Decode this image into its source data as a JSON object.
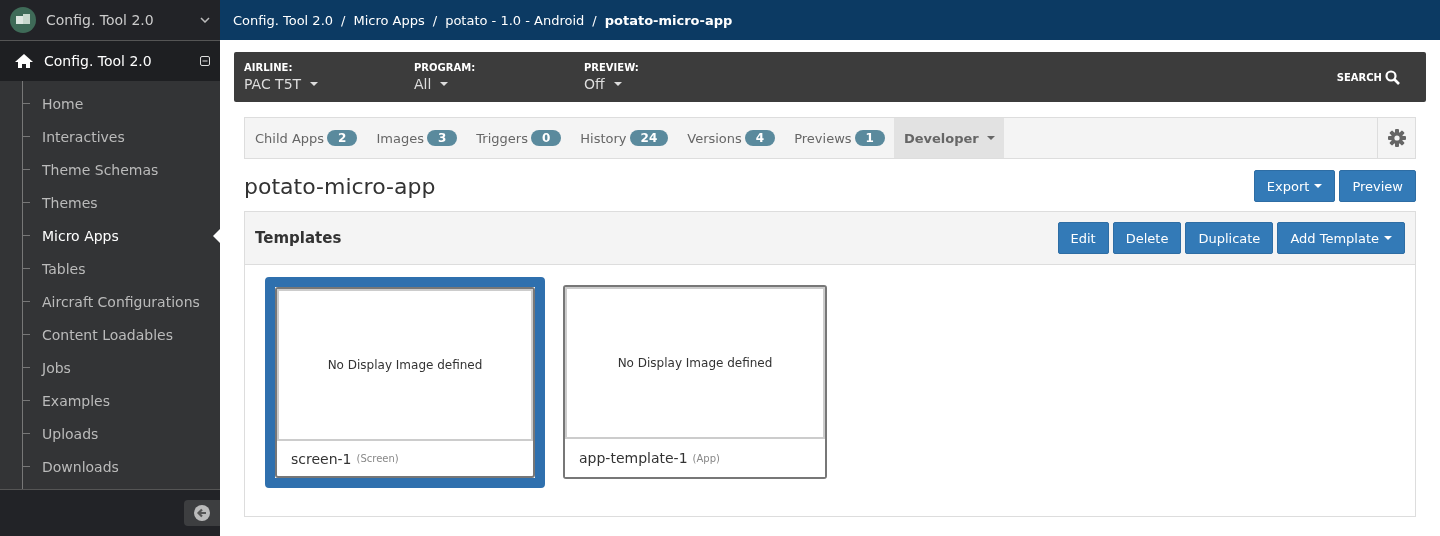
{
  "app_switcher": {
    "title": "Config. Tool 2.0"
  },
  "sidebar": {
    "section": "Config. Tool 2.0",
    "items": [
      {
        "label": "Home",
        "selected": false
      },
      {
        "label": "Interactives",
        "selected": false
      },
      {
        "label": "Theme Schemas",
        "selected": false
      },
      {
        "label": "Themes",
        "selected": false
      },
      {
        "label": "Micro Apps",
        "selected": true
      },
      {
        "label": "Tables",
        "selected": false
      },
      {
        "label": "Aircraft Configurations",
        "selected": false
      },
      {
        "label": "Content Loadables",
        "selected": false
      },
      {
        "label": "Jobs",
        "selected": false
      },
      {
        "label": "Examples",
        "selected": false
      },
      {
        "label": "Uploads",
        "selected": false
      },
      {
        "label": "Downloads",
        "selected": false
      }
    ]
  },
  "breadcrumb": [
    {
      "label": "Config. Tool 2.0",
      "current": false
    },
    {
      "label": "Micro Apps",
      "current": false
    },
    {
      "label": "potato - 1.0 - Android",
      "current": false
    },
    {
      "label": "potato-micro-app",
      "current": true
    }
  ],
  "breadcrumb_separator": "/",
  "filters": [
    {
      "label": "AIRLINE:",
      "value": "PAC T5T"
    },
    {
      "label": "PROGRAM:",
      "value": "All"
    },
    {
      "label": "PREVIEW:",
      "value": "Off"
    }
  ],
  "search": "SEARCH",
  "tabs": [
    {
      "label": "Child Apps",
      "count": "2",
      "selected": false
    },
    {
      "label": "Images",
      "count": "3",
      "selected": false
    },
    {
      "label": "Triggers",
      "count": "0",
      "selected": false
    },
    {
      "label": "History",
      "count": "24",
      "selected": false
    },
    {
      "label": "Versions",
      "count": "4",
      "selected": false
    },
    {
      "label": "Previews",
      "count": "1",
      "selected": false
    },
    {
      "label": "Developer",
      "selected": true
    }
  ],
  "title": "potato-micro-app",
  "title_buttons": [
    {
      "label": "Export",
      "dropdown": true
    },
    {
      "label": "Preview",
      "dropdown": false
    }
  ],
  "panel": {
    "title": "Templates",
    "buttons": [
      {
        "label": "Edit",
        "dropdown": false
      },
      {
        "label": "Delete",
        "dropdown": false
      },
      {
        "label": "Duplicate",
        "dropdown": false
      },
      {
        "label": "Add Template",
        "dropdown": true
      }
    ],
    "templates": [
      {
        "placeholder": "No Display Image defined",
        "name": "screen-1",
        "type": "(Screen)",
        "selected": true
      },
      {
        "placeholder": "No Display Image defined",
        "name": "app-template-1",
        "type": "(App)",
        "selected": false
      }
    ]
  }
}
